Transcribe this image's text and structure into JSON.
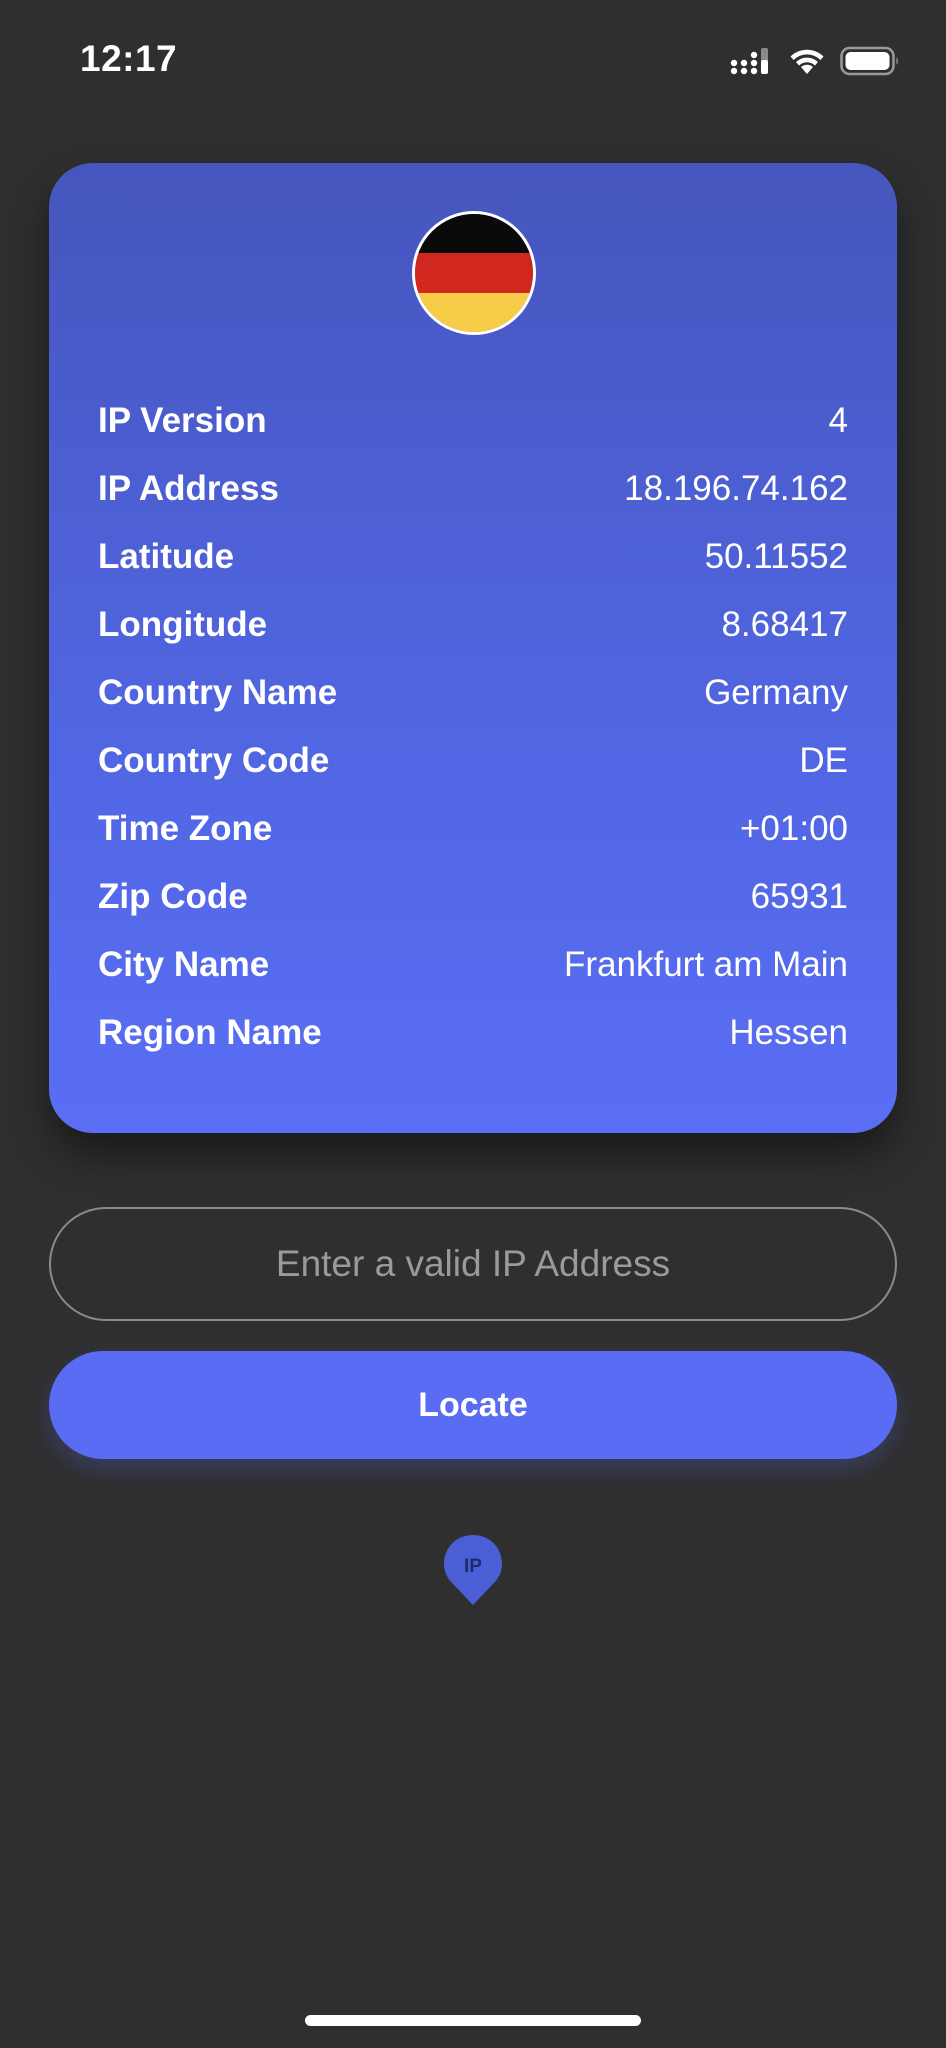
{
  "status_bar": {
    "time": "12:17",
    "icons": [
      "cellular-signal-icon",
      "wifi-icon",
      "battery-icon"
    ]
  },
  "card": {
    "flag": {
      "country": "Germany",
      "colors": [
        "#0a0a0a",
        "#d0281e",
        "#f7cd48"
      ]
    },
    "rows": [
      {
        "label": "IP Version",
        "value": "4"
      },
      {
        "label": "IP Address",
        "value": "18.196.74.162"
      },
      {
        "label": "Latitude",
        "value": "50.11552"
      },
      {
        "label": "Longitude",
        "value": "8.68417"
      },
      {
        "label": "Country Name",
        "value": "Germany"
      },
      {
        "label": "Country Code",
        "value": "DE"
      },
      {
        "label": "Time Zone",
        "value": "+01:00"
      },
      {
        "label": "Zip Code",
        "value": "65931"
      },
      {
        "label": "City Name",
        "value": "Frankfurt am Main"
      },
      {
        "label": "Region Name",
        "value": "Hessen"
      }
    ]
  },
  "form": {
    "ip_input": {
      "value": "",
      "placeholder": "Enter a valid IP Address"
    },
    "locate_label": "Locate"
  },
  "logo": {
    "text": "IP",
    "icon": "location-pin-icon"
  },
  "colors": {
    "background": "#2f2f2f",
    "accent": "#5a6cf3",
    "card_top": "#4656bd",
    "card_bottom": "#5a6ef5"
  }
}
